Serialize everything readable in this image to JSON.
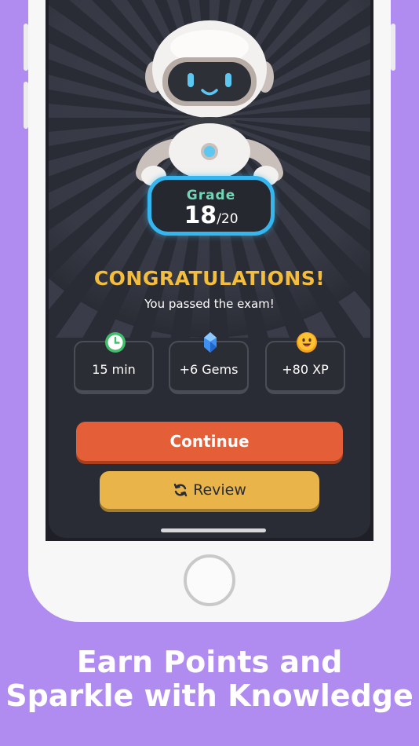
{
  "grade": {
    "label": "Grade",
    "score": "18",
    "total": "/20"
  },
  "result": {
    "title": "CONGRATULATIONS!",
    "subtitle": "You passed the exam!"
  },
  "stats": [
    {
      "icon": "clock-icon",
      "value": "15 min"
    },
    {
      "icon": "gem-icon",
      "value": "+6 Gems"
    },
    {
      "icon": "smiley-icon",
      "value": "+80 XP"
    }
  ],
  "buttons": {
    "continue": "Continue",
    "review": "Review"
  },
  "caption": {
    "line1": "Earn Points and",
    "line2": "Sparkle with Knowledge"
  },
  "colors": {
    "background": "#b18cf0",
    "screen": "#2a2c35",
    "accent_orange": "#e45f38",
    "accent_yellow": "#e9b54a",
    "title_gold": "#f4bd3c",
    "grade_border": "#35b6ef",
    "grade_label": "#6fd7b6"
  }
}
